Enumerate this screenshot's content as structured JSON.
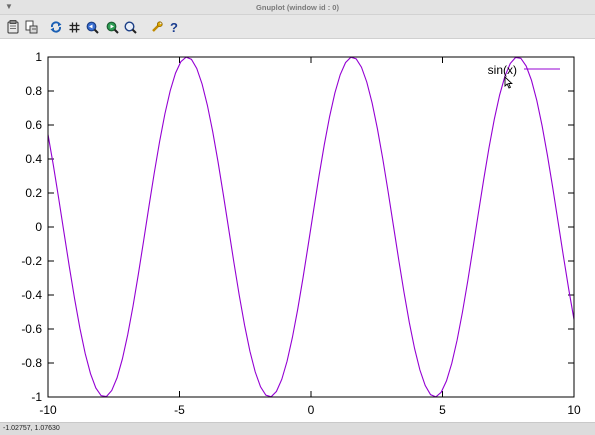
{
  "window": {
    "title": "Gnuplot (window id : 0)"
  },
  "toolbar": {
    "buttons": [
      {
        "name": "copy-to-clipboard-button",
        "icon": "clipboard-icon"
      },
      {
        "name": "print-button",
        "icon": "printer-icon"
      },
      {
        "name": "replot-button",
        "icon": "refresh-icon"
      },
      {
        "name": "grid-button",
        "icon": "grid-icon"
      },
      {
        "name": "previous-zoom-button",
        "icon": "zoom-previous-icon"
      },
      {
        "name": "next-zoom-button",
        "icon": "zoom-next-icon"
      },
      {
        "name": "autoscale-button",
        "icon": "autoscale-icon"
      },
      {
        "name": "settings-button",
        "icon": "wrench-icon"
      },
      {
        "name": "help-button",
        "icon": "question-icon"
      }
    ]
  },
  "status": {
    "coordinates": "-1.02757,  1.07630"
  },
  "colors": {
    "series": "#9400d3",
    "axis": "#000000"
  },
  "chart_data": {
    "type": "line",
    "function": "sin(x)",
    "series": [
      {
        "name": "sin(x)",
        "function": "sin(x)"
      }
    ],
    "xlim": [
      -10,
      10
    ],
    "ylim": [
      -1,
      1
    ],
    "x_ticks": [
      "-10",
      "-5",
      "0",
      "5",
      "10"
    ],
    "y_ticks": [
      "1",
      "0.8",
      "0.6",
      "0.4",
      "0.2",
      "0",
      "-0.2",
      "-0.4",
      "-0.6",
      "-0.8",
      "-1"
    ],
    "grid": false,
    "legend_position": "top-right"
  }
}
